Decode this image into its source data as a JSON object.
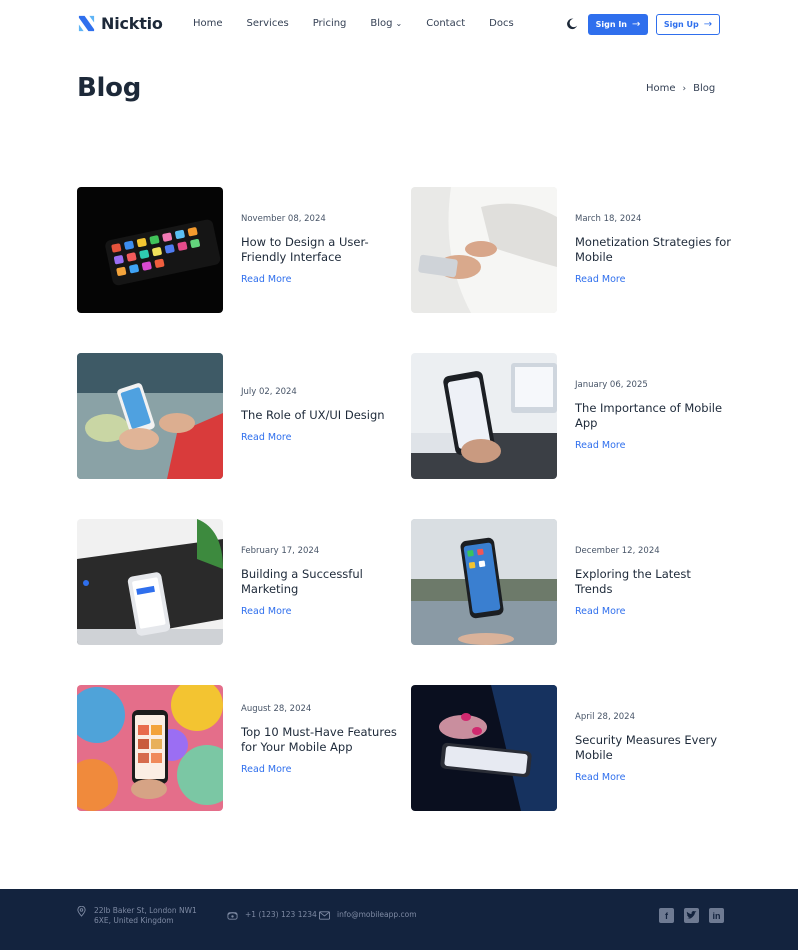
{
  "brand": {
    "name": "Nicktio",
    "primary_color": "#2f6fed",
    "dark_color": "#1d2939",
    "footer_bg": "#13233e"
  },
  "nav": {
    "items": [
      "Home",
      "Services",
      "Pricing",
      "Blog",
      "Contact",
      "Docs"
    ]
  },
  "header": {
    "signin_label": "Sign In",
    "signup_label": "Sign Up",
    "theme_icon": "moon-icon"
  },
  "page": {
    "title": "Blog",
    "breadcrumb": {
      "home": "Home",
      "current": "Blog"
    }
  },
  "posts": [
    {
      "date": "November 08, 2024",
      "title": "How to Design a User-Friendly Interface",
      "cta": "Read More"
    },
    {
      "date": "March 18, 2024",
      "title": "Monetization Strategies for Mobile",
      "cta": "Read More"
    },
    {
      "date": "July 02, 2024",
      "title": "The Role of UX/UI Design",
      "cta": "Read More"
    },
    {
      "date": "January 06, 2025",
      "title": "The Importance of Mobile App",
      "cta": "Read More"
    },
    {
      "date": "February 17, 2024",
      "title": "Building a Successful Marketing",
      "cta": "Read More"
    },
    {
      "date": "December 12, 2024",
      "title": "Exploring the Latest Trends",
      "cta": "Read More"
    },
    {
      "date": "August 28, 2024",
      "title": "Top 10 Must-Have Features for Your Mobile App",
      "cta": "Read More"
    },
    {
      "date": "April 28, 2024",
      "title": "Security Measures Every Mobile",
      "cta": "Read More"
    }
  ],
  "footer": {
    "address": "22lb Baker St, London NW1 6XE, United Kingdom",
    "phone": "+1 (123) 123 1234",
    "email": "info@mobileapp.com",
    "social": [
      "facebook-icon",
      "twitter-icon",
      "linkedin-icon"
    ]
  }
}
